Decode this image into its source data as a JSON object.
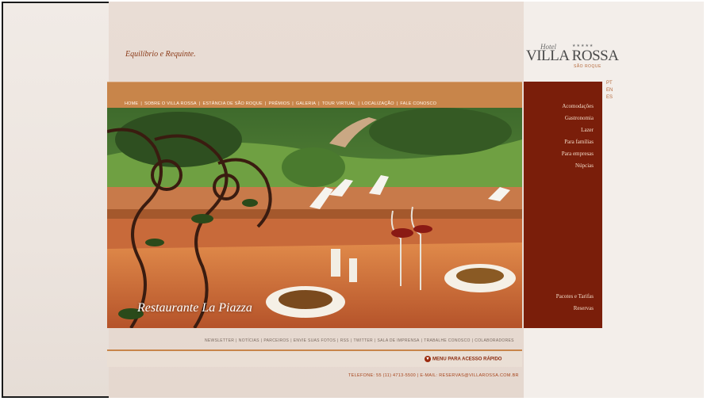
{
  "header": {
    "tagline": "Equilíbrio e Requinte.",
    "logo": {
      "hotel": "Hotel",
      "stars": "★★★★★",
      "name": "VILLA ROSSA",
      "place": "SÃO ROQUE"
    },
    "languages": [
      "PT",
      "EN",
      "ES"
    ]
  },
  "nav": {
    "items": [
      "HOME",
      "SOBRE O VILLA ROSSA",
      "ESTÂNCIA DE SÃO ROQUE",
      "PRÊMIOS",
      "GALERIA",
      "TOUR VIRTUAL",
      "LOCALIZAÇÃO",
      "FALE CONOSCO"
    ],
    "separator": "|"
  },
  "hero": {
    "caption": "Restaurante La Piazza"
  },
  "sidebar": {
    "top": [
      "Acomodações",
      "Gastronomia",
      "Lazer",
      "Para famílias",
      "Para empresas",
      "Núpcias"
    ],
    "bottom": [
      "Pacotes e Tarifas",
      "Reservas"
    ]
  },
  "footer": {
    "links": [
      "NEWSLETTER",
      "NOTÍCIAS",
      "PARCEIROS",
      "ENVIE SUAS FOTOS",
      "RSS",
      "TWITTER",
      "SALA DE IMPRENSA",
      "TRABALHE CONOSCO",
      "COLABORADORES"
    ],
    "quick_menu": "MENU PARA ACESSO RÁPIDO",
    "contact": "TELEFONE: 55 (11) 4713-5500 | E-MAIL: RESERVAS@VILLAROSSA.COM.BR"
  },
  "colors": {
    "accent": "#c8854a",
    "sidebar": "#7a1e0a",
    "text_brown": "#8a3a18"
  }
}
